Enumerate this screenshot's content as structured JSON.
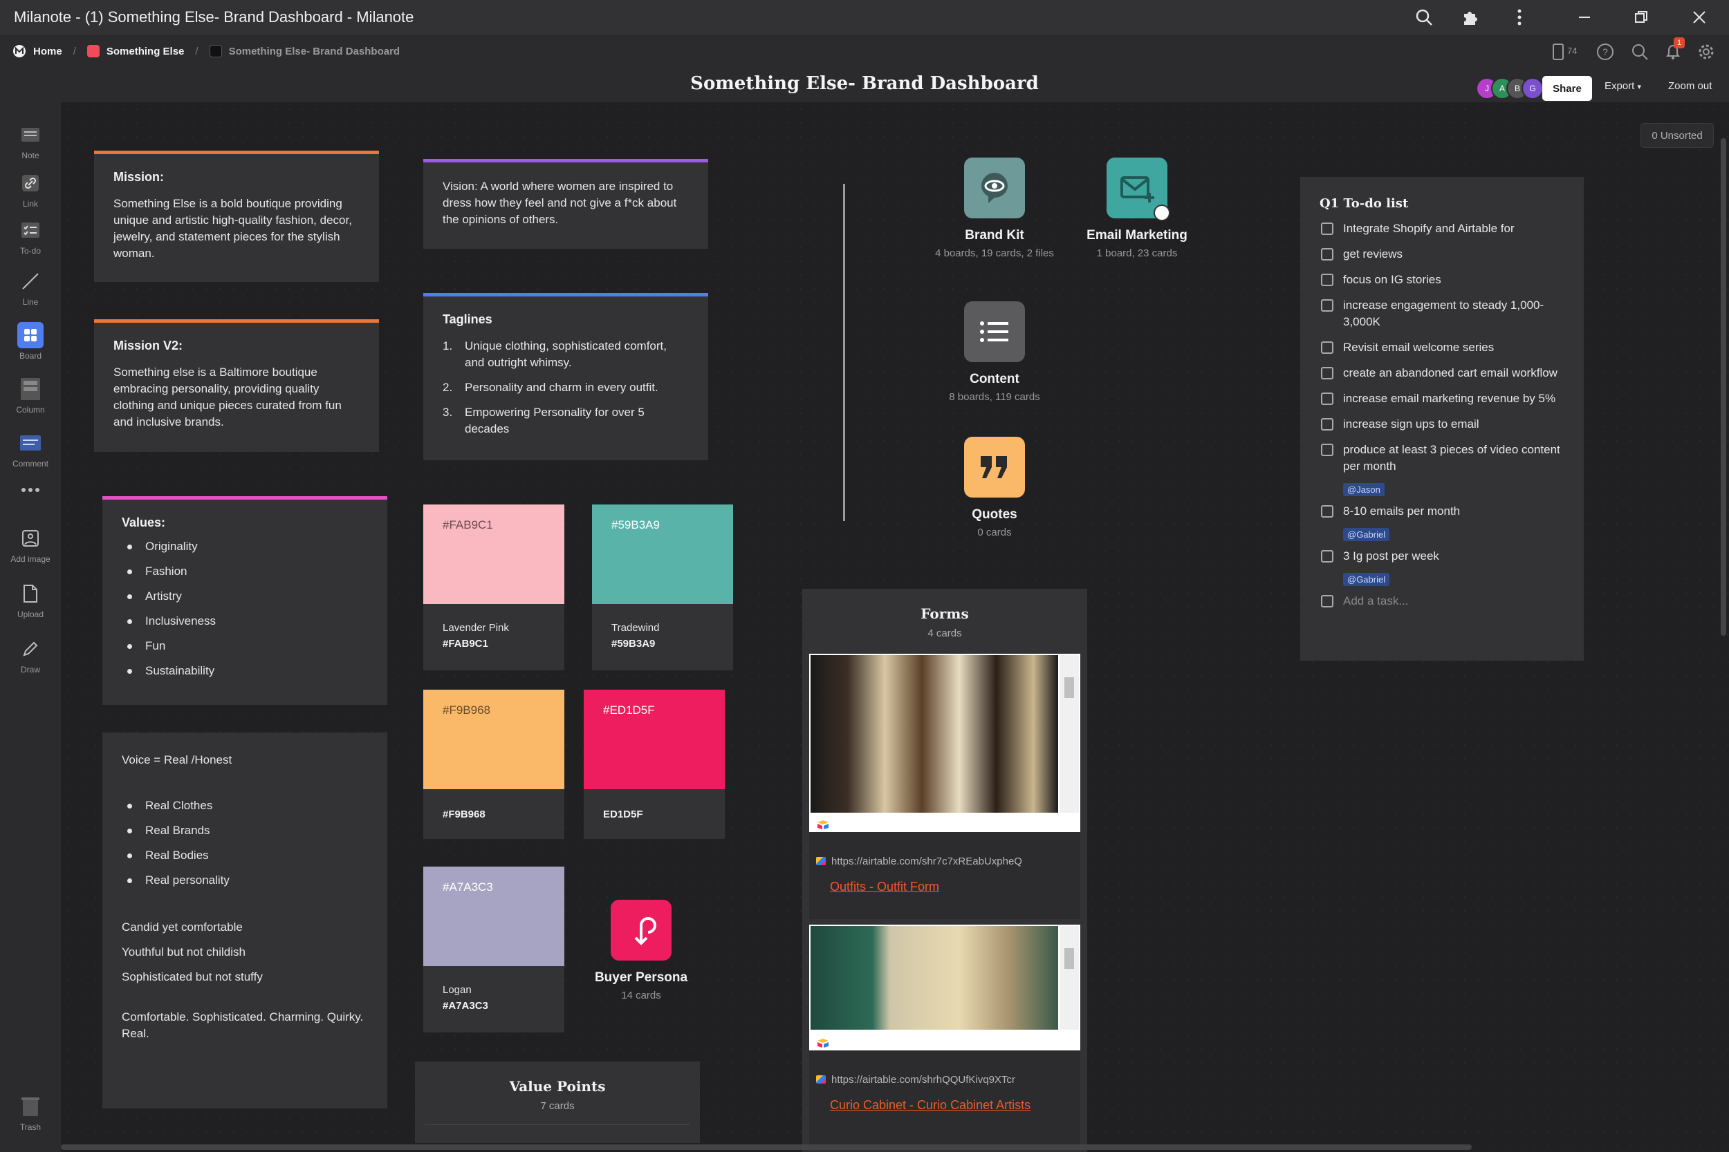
{
  "window": {
    "title": "Milanote - (1) Something Else- Brand Dashboard - Milanote"
  },
  "breadcrumb": {
    "home": "Home",
    "parent": "Something Else",
    "current": "Something Else- Brand Dashboard"
  },
  "board": {
    "title": "Something Else- Brand Dashboard"
  },
  "header": {
    "share_label": "Share",
    "export_label": "Export",
    "zoom_label": "Zoom out",
    "device_count": "74",
    "notif_count": "1",
    "avatars": [
      {
        "initial": "J",
        "color": "#b53fc9"
      },
      {
        "initial": "A",
        "color": "#2f8f5b"
      },
      {
        "initial": "B",
        "color": "#555"
      },
      {
        "initial": "G",
        "color": "#7a4fd0"
      }
    ],
    "unsorted": "0 Unsorted"
  },
  "sidebar": {
    "tools": [
      "Note",
      "Link",
      "To-do",
      "Line",
      "Board",
      "Column",
      "Comment",
      "Add image",
      "Upload",
      "Draw",
      "Trash"
    ]
  },
  "mission": {
    "heading": "Mission:",
    "text": "Something Else is a bold boutique providing unique and artistic high-quality fashion, decor, jewelry, and statement pieces for the stylish woman.",
    "accent": "#e9793a"
  },
  "mission_v2": {
    "heading": "Mission V2:",
    "text": "Something else is a Baltimore boutique embracing personality, providing quality clothing and unique pieces curated from fun and inclusive brands.",
    "accent": "#e9793a"
  },
  "values": {
    "heading": "Values:",
    "items": [
      "Originality",
      "Fashion",
      "Artistry",
      "Inclusiveness",
      "Fun",
      "Sustainability"
    ],
    "accent": "#e552c6"
  },
  "voice": {
    "heading": "Voice = Real /Honest",
    "items": [
      "Real Clothes",
      "Real Brands",
      "Real Bodies",
      "Real personality"
    ],
    "line1": "Candid yet comfortable",
    "line2": "Youthful but not childish",
    "line3": "Sophisticated but not stuffy",
    "closing": "Comfortable.  Sophisticated.  Charming. Quirky. Real."
  },
  "vision": {
    "text": "Vision: A world where women are inspired to dress how they feel and not give a f*ck about the opinions of others.",
    "accent": "#9b5de5"
  },
  "taglines": {
    "heading": "Taglines",
    "items": [
      "Unique clothing, sophisticated comfort, and outright whimsy.",
      "Personality and charm in every outfit.",
      "Empowering Personality for over 5 decades"
    ],
    "accent": "#4e7ef2"
  },
  "swatches": [
    {
      "hex_label": "#FAB9C1",
      "color": "#FAB9C1",
      "name": "Lavender Pink",
      "hex": "#FAB9C1",
      "text_color": "#6a4a4e"
    },
    {
      "hex_label": "#59B3A9",
      "color": "#59B3A9",
      "name": "Tradewind",
      "hex": "#59B3A9",
      "text_color": "#ffffff"
    },
    {
      "hex_label": "#F9B968",
      "color": "#F9B968",
      "name": "",
      "hex": "#F9B968",
      "text_color": "#6a4a2a"
    },
    {
      "hex_label": "#ED1D5F",
      "color": "#ED1D5F",
      "name": "",
      "hex": "ED1D5F",
      "text_color": "#ffffff"
    },
    {
      "hex_label": "#A7A3C3",
      "color": "#A7A3C3",
      "name": "Logan",
      "hex": "#A7A3C3",
      "text_color": "#ffffff"
    }
  ],
  "boards": [
    {
      "title": "Brand Kit",
      "subtitle": "4 boards, 19 cards, 2 files",
      "color": "#6e9a9a",
      "icon": "eye-speech-icon"
    },
    {
      "title": "Email Marketing",
      "subtitle": "1 board, 23 cards",
      "color": "#3fa7a0",
      "icon": "mail-plus-icon"
    },
    {
      "title": "Content",
      "subtitle": "8 boards, 119 cards",
      "color": "#5b5b5e",
      "icon": "list-icon"
    },
    {
      "title": "Quotes",
      "subtitle": "0 cards",
      "color": "#f9b968",
      "icon": "quote-icon"
    },
    {
      "title": "Buyer Persona",
      "subtitle": "14 cards",
      "color": "#ed1d5f",
      "icon": "persona-icon"
    }
  ],
  "forms": {
    "title": "Forms",
    "count": "4 cards",
    "items": [
      {
        "url": "https://airtable.com/shr7c7xREabUxpheQ",
        "link": "Outfits - Outfit Form"
      },
      {
        "url": "https://airtable.com/shrhQQUfKivq9XTcr",
        "link": "Curio Cabinet - Curio Cabinet Artists"
      }
    ]
  },
  "value_points": {
    "title": "Value Points",
    "count": "7 cards"
  },
  "todo": {
    "title": "Q1 To-do list",
    "tasks": [
      {
        "text": "Integrate Shopify and Airtable for"
      },
      {
        "text": "get reviews"
      },
      {
        "text": "focus on IG stories"
      },
      {
        "text": "increase engagement to steady 1,000-3,000K"
      },
      {
        "text": "Revisit email welcome series"
      },
      {
        "text": "create an abandoned cart email workflow"
      },
      {
        "text": "increase email marketing revenue by 5%"
      },
      {
        "text": "increase sign ups to email"
      },
      {
        "text": "produce at least 3 pieces of video content per month",
        "mention": "@Jason"
      },
      {
        "text": "8-10 emails per month",
        "mention": "@Gabriel"
      },
      {
        "text": "3 Ig post per week",
        "mention": "@Gabriel"
      }
    ],
    "add_placeholder": "Add a task..."
  }
}
